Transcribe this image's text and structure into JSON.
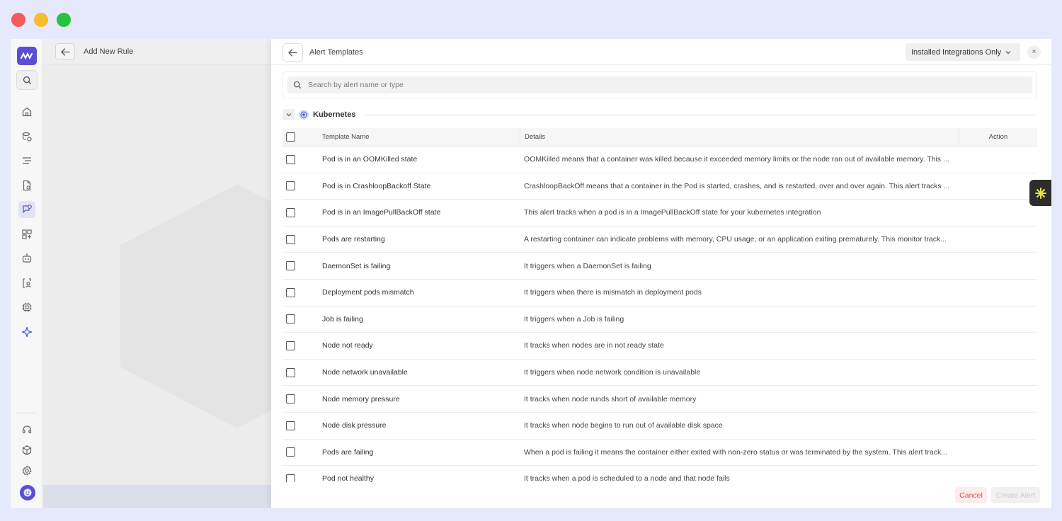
{
  "page": {
    "title": "Add New Rule"
  },
  "drawer": {
    "title": "Alert Templates",
    "filter_value": "Installed Integrations Only",
    "close_label": "×",
    "search_placeholder": "Search by alert name or type",
    "group_label": "Kubernetes",
    "columns": {
      "name": "Template Name",
      "details": "Details",
      "action": "Action"
    },
    "rows": [
      {
        "name": "Pod is in an OOMKilled state",
        "details": "OOMKilled means that a container was killed because it exceeded memory limits or the node ran out of available memory. This ..."
      },
      {
        "name": "Pod is in CrashloopBackoff State",
        "details": "CrashloopBackOff means that a container in the Pod is started, crashes, and is restarted, over and over again. This alert tracks ..."
      },
      {
        "name": "Pod is in an ImagePullBackOff state",
        "details": "This alert tracks when a pod is in a ImagePullBackOff state for your kubernetes integration"
      },
      {
        "name": "Pods are restarting",
        "details": "A restarting container can indicate problems with memory, CPU usage, or an application exiting prematurely. This monitor track..."
      },
      {
        "name": "DaemonSet is failing",
        "details": "It triggers when a DaemonSet is failing"
      },
      {
        "name": "Deployment pods mismatch",
        "details": "It triggers when there is mismatch in deployment pods"
      },
      {
        "name": "Job is failing",
        "details": "It triggers when a Job is failing"
      },
      {
        "name": "Node not ready",
        "details": "It tracks when nodes are in not ready state"
      },
      {
        "name": "Node network unavailable",
        "details": "It triggers when node network condition is unavailable"
      },
      {
        "name": "Node memory pressure",
        "details": "It tracks when node runds short of available memory"
      },
      {
        "name": "Node disk pressure",
        "details": "It tracks when node begins to run out of available disk space"
      },
      {
        "name": "Pods are failing",
        "details": "When a pod is failing it means the container either exited with non-zero status or was terminated by the system. This alert track..."
      },
      {
        "name": "Pod not healthy",
        "details": "It tracks when a pod is scheduled to a node and that node fails"
      }
    ],
    "cancel_label": "Cancel",
    "create_label": "Create Alert"
  },
  "colors": {
    "accent": "#5b4fd1",
    "cancel_text": "#e0524f",
    "cancel_bg": "#fdecec"
  }
}
